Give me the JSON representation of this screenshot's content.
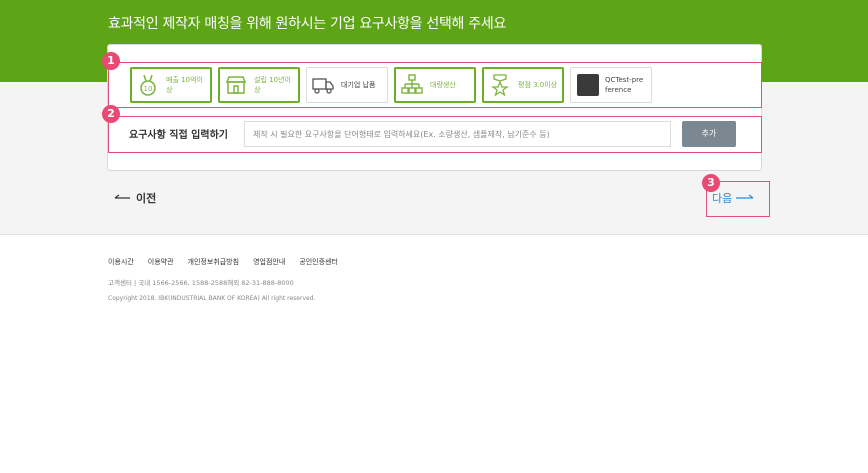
{
  "header": {
    "title": "효과적인 제작자 매칭을 위해 원하시는 기업 요구사항을 선택해 주세요"
  },
  "annotations": {
    "badge1": "1",
    "badge2": "2",
    "badge3": "3"
  },
  "requirement_chips": [
    {
      "label": "매출 10억이상",
      "icon": "medal-10-icon",
      "selected": true
    },
    {
      "label": "설립 10년이상",
      "icon": "storefront-icon",
      "selected": true
    },
    {
      "label": "대기업 납품",
      "icon": "truck-icon",
      "selected": false
    },
    {
      "label": "대량생산",
      "icon": "hierarchy-icon",
      "selected": true
    },
    {
      "label": "평점 3.0이상",
      "icon": "star-ribbon-icon",
      "selected": true
    },
    {
      "label": "QCTest-preference",
      "icon": "thumbnail-image",
      "selected": false
    }
  ],
  "custom_requirement": {
    "label": "요구사항 직접 입력하기",
    "placeholder": "제작 시 필요한 요구사항을 단어형태로 입력하세요(Ex. 소량생산, 샘플제작, 납기준수 등)",
    "value": "",
    "add_button": "추가"
  },
  "navigation": {
    "prev_label": "이전",
    "next_label": "다음"
  },
  "footer": {
    "links": [
      "이용시간",
      "이용약관",
      "개인정보취급방침",
      "영업점안내",
      "공인인증센터"
    ],
    "contact": "고객센터 | 국내 1566-2566, 1588-2588해외 82-31-888-8000",
    "copyright": "Copyright 2018. IBK(INDUSTRIAL BANK OF KOREA) All right reserved."
  },
  "colors": {
    "brand_green": "#5ea417",
    "annotation_pink": "#e84a74",
    "link_blue": "#2a8ad8"
  }
}
